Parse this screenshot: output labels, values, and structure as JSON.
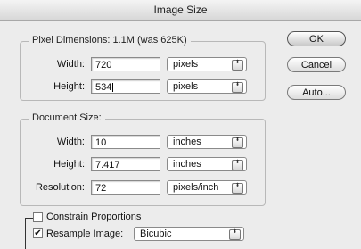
{
  "window": {
    "title": "Image Size"
  },
  "pixel_dimensions": {
    "label": "Pixel Dimensions:  1.1M (was 625K)",
    "width_label": "Width:",
    "width_value": "720",
    "width_unit": "pixels",
    "height_label": "Height:",
    "height_value": "534",
    "height_unit": "pixels"
  },
  "document_size": {
    "label": "Document Size:",
    "width_label": "Width:",
    "width_value": "10",
    "width_unit": "inches",
    "height_label": "Height:",
    "height_value": "7.417",
    "height_unit": "inches",
    "resolution_label": "Resolution:",
    "resolution_value": "72",
    "resolution_unit": "pixels/inch"
  },
  "options": {
    "constrain_label": "Constrain Proportions",
    "constrain_checked": false,
    "resample_label": "Resample Image:",
    "resample_checked": true,
    "resample_method": "Bicubic"
  },
  "buttons": {
    "ok": "OK",
    "cancel": "Cancel",
    "auto": "Auto..."
  },
  "icons": {
    "select_arrows": "⬍"
  }
}
